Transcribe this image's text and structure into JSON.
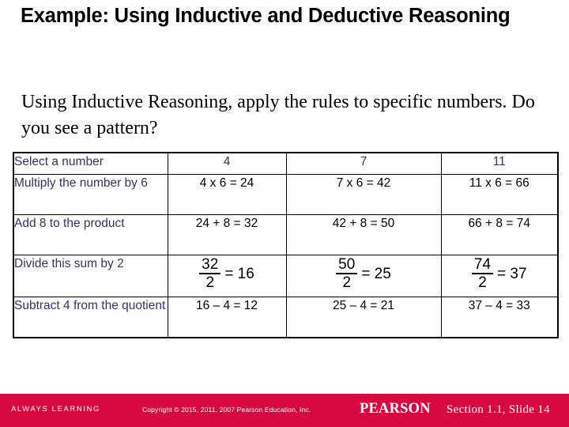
{
  "slide": {
    "title": "Example:  Using Inductive and Deductive Reasoning",
    "subtitle": "Using Inductive Reasoning, apply the rules to specific numbers.  Do you see a pattern?"
  },
  "table": {
    "header": {
      "label": "Select a number",
      "values": [
        "4",
        "7",
        "11"
      ]
    },
    "rows": [
      {
        "label": "Multiply the number by 6",
        "values": [
          "4 x 6 = 24",
          "7 x 6 = 42",
          "11 x 6 = 66"
        ],
        "type": "text"
      },
      {
        "label": "Add 8 to the product",
        "values": [
          "24 + 8 = 32",
          "42 + 8 = 50",
          "66 + 8 = 74"
        ],
        "type": "text"
      },
      {
        "label": "Divide this sum by 2",
        "type": "fraction",
        "fractions": [
          {
            "numerator": "32",
            "denominator": "2",
            "result": "= 16"
          },
          {
            "numerator": "50",
            "denominator": "2",
            "result": "= 25"
          },
          {
            "numerator": "74",
            "denominator": "2",
            "result": "= 37"
          }
        ]
      },
      {
        "label": "Subtract 4 from the quotient",
        "values": [
          "16 – 4 = 12",
          "25 – 4 = 21",
          "37 – 4 = 33"
        ],
        "type": "text"
      }
    ]
  },
  "footer": {
    "tagline": "ALWAYS LEARNING",
    "copyright": "Copyright © 2015, 2011, 2007 Pearson Education, Inc.",
    "brand": "PEARSON",
    "slide_info": "Section 1.1, Slide 14",
    "background_color": "#d5083f"
  },
  "colors": {
    "label_text": "#333366",
    "data_text": "#000000",
    "footer_bg": "#d5083f"
  }
}
